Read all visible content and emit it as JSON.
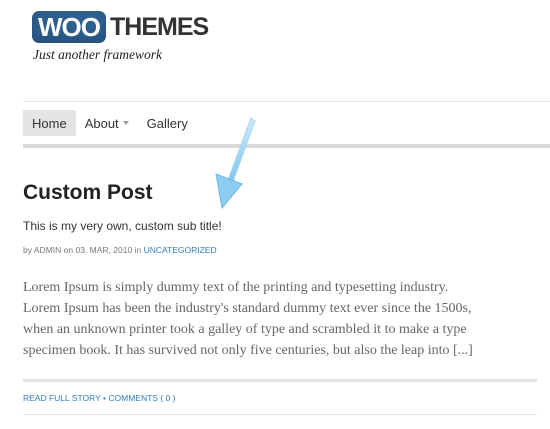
{
  "header": {
    "logo_left": "WOO",
    "logo_right": "THEMES",
    "tagline": "Just another framework"
  },
  "nav": {
    "items": [
      {
        "label": "Home",
        "active": true
      },
      {
        "label": "About",
        "has_dropdown": true
      },
      {
        "label": "Gallery"
      }
    ]
  },
  "post": {
    "title": "Custom Post",
    "subtitle": "This is my very own, custom sub title!",
    "meta": {
      "by": "by",
      "author": "ADMIN",
      "on": "on",
      "date": "03. MAR, 2010",
      "in": "in",
      "category": "UNCATEGORIZED"
    },
    "body_lines": [
      "Lorem Ipsum is simply dummy text of the printing and typesetting industry.",
      "Lorem Ipsum has been the industry's standard dummy text ever since the 1500s,",
      "when an unknown printer took a galley of type and scrambled it to make a type",
      "specimen book. It has survived not only five centuries, but also the leap into [...]"
    ],
    "links": {
      "read_more": "READ FULL STORY",
      "separator": "•",
      "comments": "COMMENTS ( 0 )"
    }
  },
  "colors": {
    "brand_blue": "#2d5f8f",
    "link_blue": "#2e7cc1",
    "arrow_blue": "#7ec6ee"
  }
}
